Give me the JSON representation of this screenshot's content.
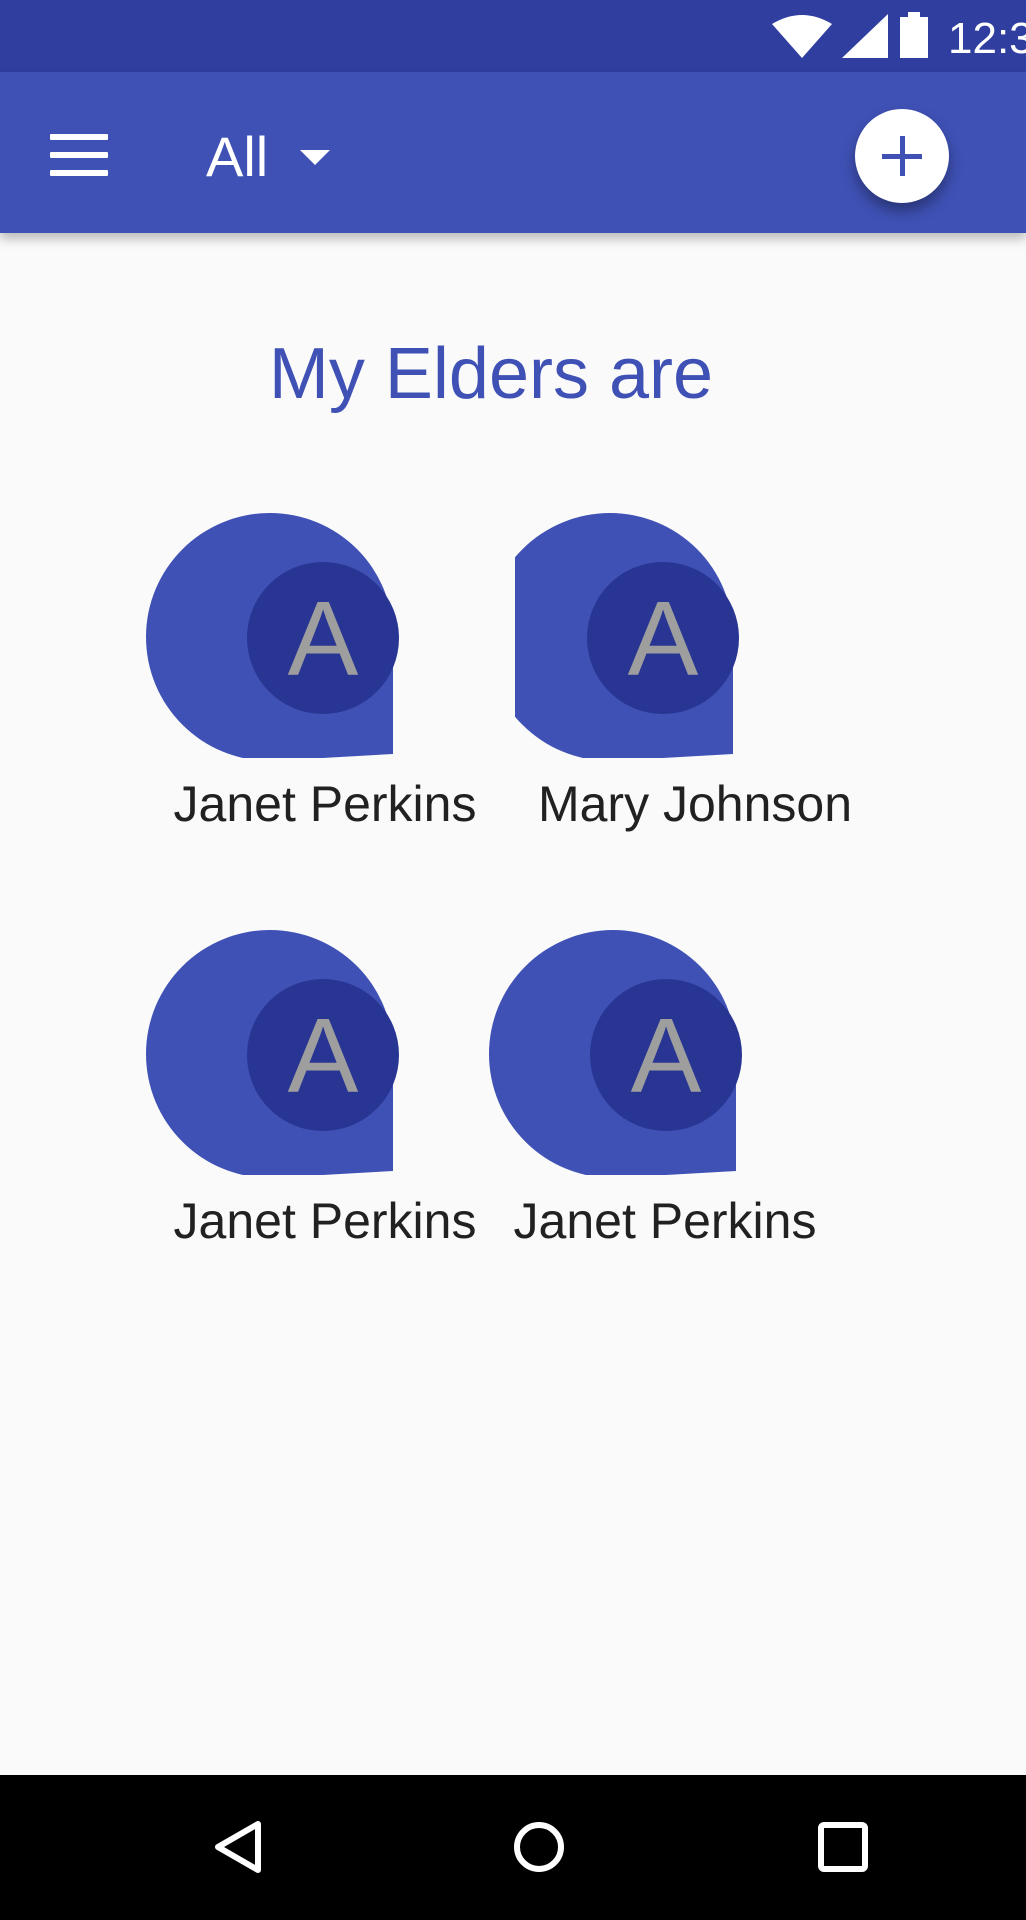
{
  "status_bar": {
    "time": "12:3",
    "icons": [
      "wifi-icon",
      "signal-icon",
      "battery-icon"
    ]
  },
  "app_bar": {
    "menu_icon": "menu-icon",
    "filter_label": "All",
    "filter_icon": "dropdown-arrow-icon",
    "add_icon": "plus-icon"
  },
  "main": {
    "heading": "My Elders are",
    "elders": [
      {
        "name": "Janet Perkins",
        "initial": "A"
      },
      {
        "name": "Mary Johnson",
        "initial": "A"
      },
      {
        "name": "Janet Perkins",
        "initial": "A"
      },
      {
        "name": "Janet Perkins",
        "initial": "A"
      }
    ]
  },
  "nav_bar": {
    "icons": [
      "back-icon",
      "home-icon",
      "recents-icon"
    ]
  },
  "colors": {
    "primary": "#3f51b5",
    "primary_dark": "#303f9f",
    "avatar_inner": "#283593",
    "avatar_letter": "#9e9e9e",
    "background": "#fafafa"
  }
}
